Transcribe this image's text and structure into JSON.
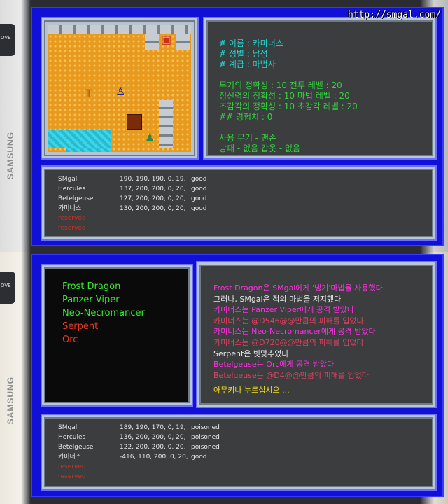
{
  "watermark": "http://smgal.com/",
  "device": {
    "brand": "SAMSUNG",
    "side_button_label": "OVE"
  },
  "top_screen": {
    "character_info": [
      {
        "text": "# 이름 : 카미너스",
        "color": "cyan"
      },
      {
        "text": "# 성별 : 남성",
        "color": "cyan"
      },
      {
        "text": "# 계급 : 마법사",
        "color": "cyan"
      },
      {
        "text": "",
        "color": "cyan"
      },
      {
        "text": "무기의 정확성 : 10   전투 레벨   : 20",
        "color": "green"
      },
      {
        "text": "정신력의 정확성 : 10   마법 레벨   : 20",
        "color": "green"
      },
      {
        "text": "초감각의 정확성 : 10   초감각 레벨 : 20",
        "color": "green"
      },
      {
        "text": "## 경험치 : 0",
        "color": "green"
      },
      {
        "text": "",
        "color": "green"
      },
      {
        "text": "사용 무기 - 맨손",
        "color": "green"
      },
      {
        "text": "방패 - 없음            갑옷 - 없음",
        "color": "green"
      }
    ],
    "party": [
      {
        "name": "SMgal",
        "stats": "190, 190, 190, 0, 19,",
        "status": "good"
      },
      {
        "name": "Hercules",
        "stats": "137, 200, 200, 0, 20,",
        "status": "good"
      },
      {
        "name": "Betelgeuse",
        "stats": "127, 200, 200, 0, 20,",
        "status": "good"
      },
      {
        "name": "카미너스",
        "stats": "130, 200, 200, 0, 20,",
        "status": "good"
      },
      {
        "name": "reserved",
        "stats": "",
        "status": "",
        "reserved": true
      },
      {
        "name": "reserved",
        "stats": "",
        "status": "",
        "reserved": true
      }
    ]
  },
  "bottom_screen": {
    "enemies": [
      {
        "name": "Frost Dragon",
        "state": "alive"
      },
      {
        "name": "Panzer Viper",
        "state": "alive"
      },
      {
        "name": "Neo-Necromancer",
        "state": "alive"
      },
      {
        "name": "Serpent",
        "state": "dead"
      },
      {
        "name": "Orc",
        "state": "dead"
      }
    ],
    "battle_log": [
      {
        "text": "Frost Dragon은 SMgal에게 '냉기'마법을 사용했다",
        "color": "magenta"
      },
      {
        "text": "그러나, SMgal은 적의 마법을 저지했다",
        "color": "white"
      },
      {
        "text": "카미너스는 Panzer Viper에게 공격 받았다",
        "color": "magenta"
      },
      {
        "text": "카미너스는 @D546@@만큼의 피해를 입었다",
        "color": "red"
      },
      {
        "text": "카미너스는 Neo-Necromancer에게 공격 받았다",
        "color": "magenta"
      },
      {
        "text": "카미너스는 @D720@@만큼의 피해를 입었다",
        "color": "red"
      },
      {
        "text": "Serpent은 빗맞추었다",
        "color": "white"
      },
      {
        "text": "Betelgeuse는 Orc에게 공격 받았다",
        "color": "magenta"
      },
      {
        "text": "Betelgeuse는 @D4@@만큼의 피해를 입었다",
        "color": "red"
      }
    ],
    "prompt": "아무키나 누르십시오 ...",
    "party": [
      {
        "name": "SMgal",
        "stats": "189, 190, 170, 0, 19,",
        "status": "poisoned"
      },
      {
        "name": "Hercules",
        "stats": "136, 200, 200, 0, 20,",
        "status": "poisoned"
      },
      {
        "name": "Betelgeuse",
        "stats": "122, 200, 200, 0, 20,",
        "status": "poisoned"
      },
      {
        "name": "카미너스",
        "stats": "-416, 110, 200, 0, 20,",
        "status": "good"
      },
      {
        "name": "reserved",
        "stats": "",
        "status": "",
        "reserved": true
      },
      {
        "name": "reserved",
        "stats": "",
        "status": "",
        "reserved": true
      }
    ]
  }
}
